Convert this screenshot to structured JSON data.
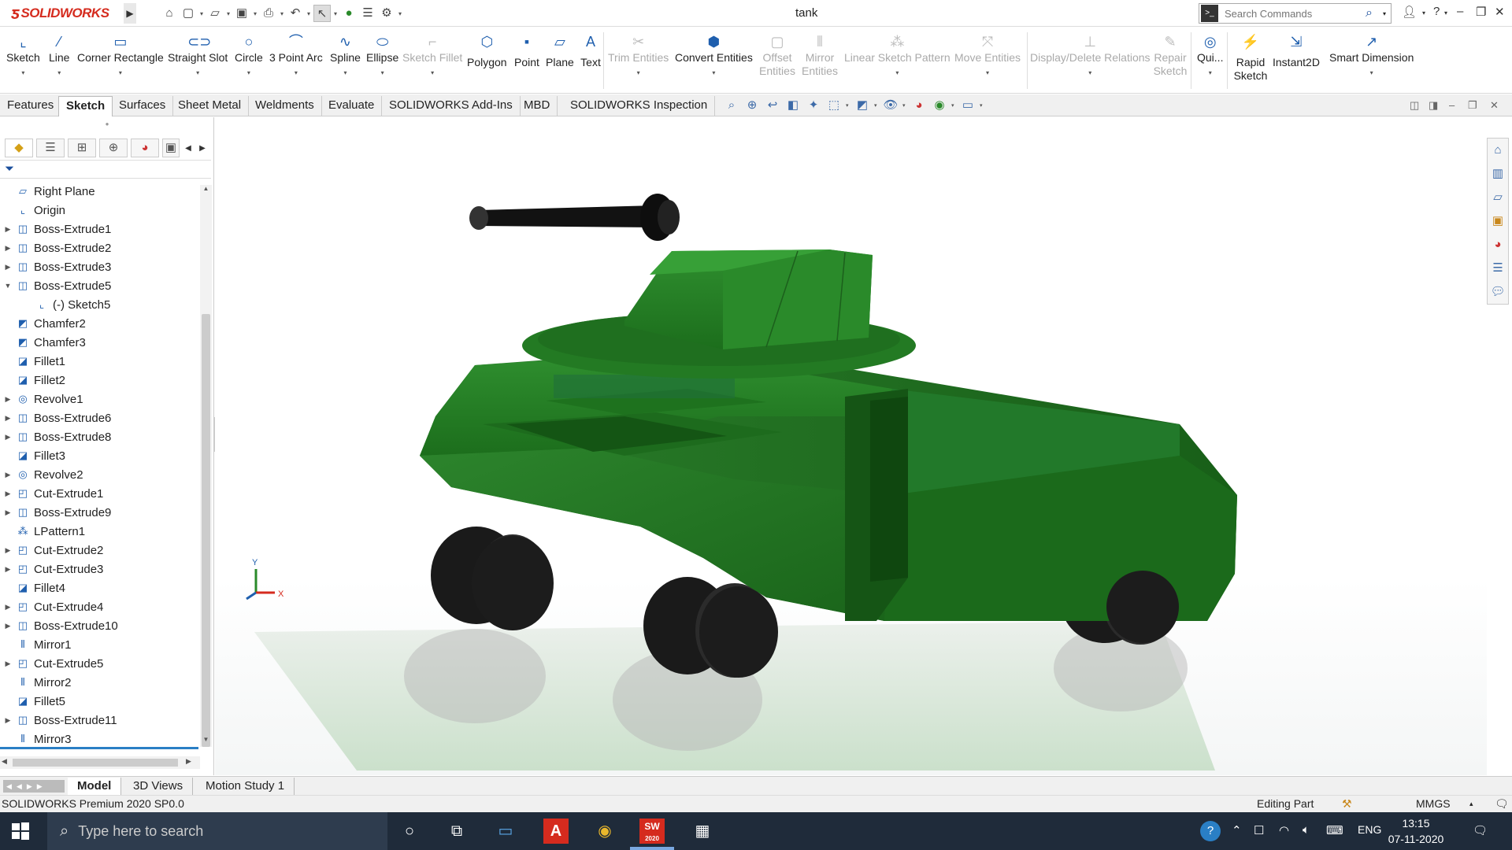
{
  "app": {
    "brand": "SOLIDWORKS",
    "title": "tank"
  },
  "search": {
    "placeholder": "Search Commands"
  },
  "ribbon": [
    {
      "label": "Sketch",
      "icon": "sketch-icon",
      "enabled": true
    },
    {
      "label": "Line",
      "icon": "line-icon",
      "enabled": true
    },
    {
      "label": "Corner Rectangle",
      "icon": "rectangle-icon",
      "enabled": true
    },
    {
      "label": "Straight Slot",
      "icon": "slot-icon",
      "enabled": true
    },
    {
      "label": "Circle",
      "icon": "circle-icon",
      "enabled": true
    },
    {
      "label": "3 Point Arc",
      "icon": "arc-icon",
      "enabled": true
    },
    {
      "label": "Spline",
      "icon": "spline-icon",
      "enabled": true
    },
    {
      "label": "Ellipse",
      "icon": "ellipse-icon",
      "enabled": true
    },
    {
      "label": "Sketch Fillet",
      "icon": "fillet-icon",
      "enabled": false
    },
    {
      "label": "Polygon",
      "icon": "polygon-icon",
      "enabled": true
    },
    {
      "label": "Point",
      "icon": "point-icon",
      "enabled": true
    },
    {
      "label": "Plane",
      "icon": "plane-icon",
      "enabled": true
    },
    {
      "label": "Text",
      "icon": "text-icon",
      "enabled": true
    },
    {
      "label": "Trim Entities",
      "icon": "trim-icon",
      "enabled": false
    },
    {
      "label": "Convert Entities",
      "icon": "convert-icon",
      "enabled": true
    },
    {
      "label": "Offset Entities",
      "icon": "offset-icon",
      "enabled": false
    },
    {
      "label": "Mirror Entities",
      "icon": "mirror-icon",
      "enabled": false
    },
    {
      "label": "Linear Sketch Pattern",
      "icon": "pattern-icon",
      "enabled": false
    },
    {
      "label": "Move Entities",
      "icon": "move-icon",
      "enabled": false
    },
    {
      "label": "Display/Delete Relations",
      "icon": "relations-icon",
      "enabled": false
    },
    {
      "label": "Repair Sketch",
      "icon": "repair-icon",
      "enabled": false
    },
    {
      "label": "Qui...",
      "icon": "quick-snaps-icon",
      "enabled": true
    },
    {
      "label": "Rapid Sketch",
      "icon": "rapid-sketch-icon",
      "enabled": true
    },
    {
      "label": "Instant2D",
      "icon": "instant2d-icon",
      "enabled": true
    },
    {
      "label": "Smart Dimension",
      "icon": "smart-dimension-icon",
      "enabled": true
    }
  ],
  "tabs": [
    "Features",
    "Sketch",
    "Surfaces",
    "Sheet Metal",
    "Weldments",
    "Evaluate",
    "SOLIDWORKS Add-Ins",
    "MBD",
    "SOLIDWORKS Inspection"
  ],
  "active_tab": "Sketch",
  "tree": [
    {
      "label": "Right Plane",
      "icon": "plane-icon",
      "expandable": false,
      "indent": 0
    },
    {
      "label": "Origin",
      "icon": "origin-icon",
      "expandable": false,
      "indent": 0
    },
    {
      "label": "Boss-Extrude1",
      "icon": "extrude-icon",
      "expandable": true,
      "indent": 0
    },
    {
      "label": "Boss-Extrude2",
      "icon": "extrude-icon",
      "expandable": true,
      "indent": 0
    },
    {
      "label": "Boss-Extrude3",
      "icon": "extrude-icon",
      "expandable": true,
      "indent": 0
    },
    {
      "label": "Boss-Extrude5",
      "icon": "extrude-icon",
      "expandable": true,
      "expanded": true,
      "indent": 0
    },
    {
      "label": "(-) Sketch5",
      "icon": "sketch-icon",
      "expandable": false,
      "indent": 1
    },
    {
      "label": "Chamfer2",
      "icon": "chamfer-icon",
      "expandable": false,
      "indent": 0
    },
    {
      "label": "Chamfer3",
      "icon": "chamfer-icon",
      "expandable": false,
      "indent": 0
    },
    {
      "label": "Fillet1",
      "icon": "fillet-icon",
      "expandable": false,
      "indent": 0
    },
    {
      "label": "Fillet2",
      "icon": "fillet-icon",
      "expandable": false,
      "indent": 0
    },
    {
      "label": "Revolve1",
      "icon": "revolve-icon",
      "expandable": true,
      "indent": 0
    },
    {
      "label": "Boss-Extrude6",
      "icon": "extrude-icon",
      "expandable": true,
      "indent": 0
    },
    {
      "label": "Boss-Extrude8",
      "icon": "extrude-icon",
      "expandable": true,
      "indent": 0
    },
    {
      "label": "Fillet3",
      "icon": "fillet-icon",
      "expandable": false,
      "indent": 0
    },
    {
      "label": "Revolve2",
      "icon": "revolve-icon",
      "expandable": true,
      "indent": 0
    },
    {
      "label": "Cut-Extrude1",
      "icon": "cut-extrude-icon",
      "expandable": true,
      "indent": 0
    },
    {
      "label": "Boss-Extrude9",
      "icon": "extrude-icon",
      "expandable": true,
      "indent": 0
    },
    {
      "label": "LPattern1",
      "icon": "pattern-icon",
      "expandable": false,
      "indent": 0
    },
    {
      "label": "Cut-Extrude2",
      "icon": "cut-extrude-icon",
      "expandable": true,
      "indent": 0
    },
    {
      "label": "Cut-Extrude3",
      "icon": "cut-extrude-icon",
      "expandable": true,
      "indent": 0
    },
    {
      "label": "Fillet4",
      "icon": "fillet-icon",
      "expandable": false,
      "indent": 0
    },
    {
      "label": "Cut-Extrude4",
      "icon": "cut-extrude-icon",
      "expandable": true,
      "indent": 0
    },
    {
      "label": "Boss-Extrude10",
      "icon": "extrude-icon",
      "expandable": true,
      "indent": 0
    },
    {
      "label": "Mirror1",
      "icon": "mirror-icon",
      "expandable": false,
      "indent": 0
    },
    {
      "label": "Cut-Extrude5",
      "icon": "cut-extrude-icon",
      "expandable": true,
      "indent": 0
    },
    {
      "label": "Mirror2",
      "icon": "mirror-icon",
      "expandable": false,
      "indent": 0
    },
    {
      "label": "Fillet5",
      "icon": "fillet-icon",
      "expandable": false,
      "indent": 0
    },
    {
      "label": "Boss-Extrude11",
      "icon": "extrude-icon",
      "expandable": true,
      "indent": 0
    },
    {
      "label": "Mirror3",
      "icon": "mirror-icon",
      "expandable": false,
      "indent": 0
    }
  ],
  "bottom_tabs": [
    "Model",
    "3D Views",
    "Motion Study 1"
  ],
  "active_bottom_tab": "Model",
  "status": {
    "left": "SOLIDWORKS Premium 2020 SP0.0",
    "mode": "Editing Part",
    "units": "MMGS"
  },
  "triad": {
    "y": "Y",
    "x": "X"
  },
  "taskbar": {
    "search_placeholder": "Type here to search",
    "lang": "ENG",
    "time": "13:15",
    "date": "07-11-2020",
    "solidworks_badge": "SW",
    "solidworks_year": "2020"
  },
  "colors": {
    "brand_red": "#d52b1e",
    "tank_green": "#1f7a1f",
    "accent_blue": "#1f5fae",
    "taskbar": "#1f2b3a"
  }
}
